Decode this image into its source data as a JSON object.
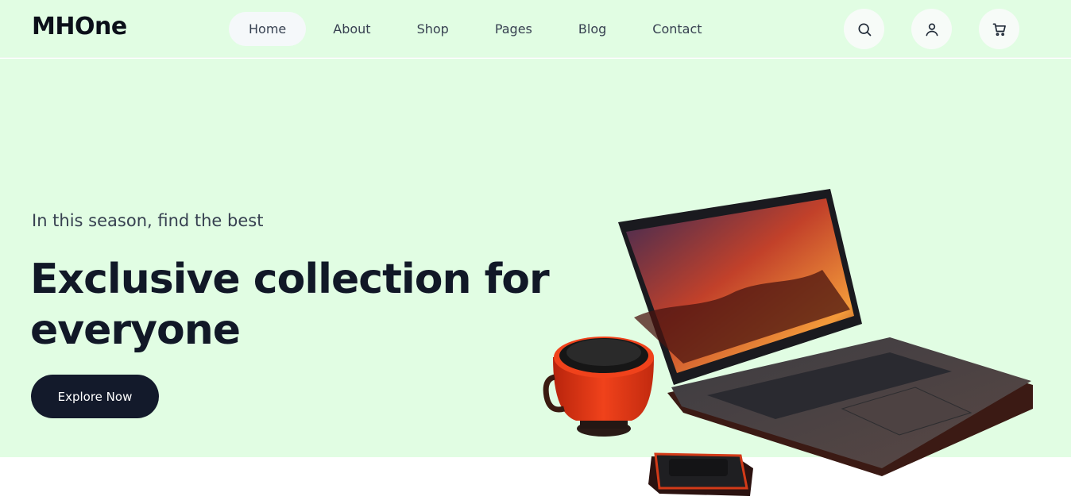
{
  "brand": {
    "logo": "MHOne"
  },
  "nav": {
    "items": [
      {
        "label": "Home",
        "active": true
      },
      {
        "label": "About"
      },
      {
        "label": "Shop"
      },
      {
        "label": "Pages"
      },
      {
        "label": "Blog"
      },
      {
        "label": "Contact"
      }
    ]
  },
  "header_actions": [
    "search-icon",
    "user-icon",
    "cart-icon"
  ],
  "hero": {
    "eyebrow": "In this season, find the best",
    "headline": "Exclusive collection for everyone",
    "cta_label": "Explore Now",
    "image": "laptop-mug-and-powerbank"
  },
  "colors": {
    "hero_bg": "#e1fde3",
    "button_bg": "#131a2b",
    "accent": "#e8431a"
  }
}
